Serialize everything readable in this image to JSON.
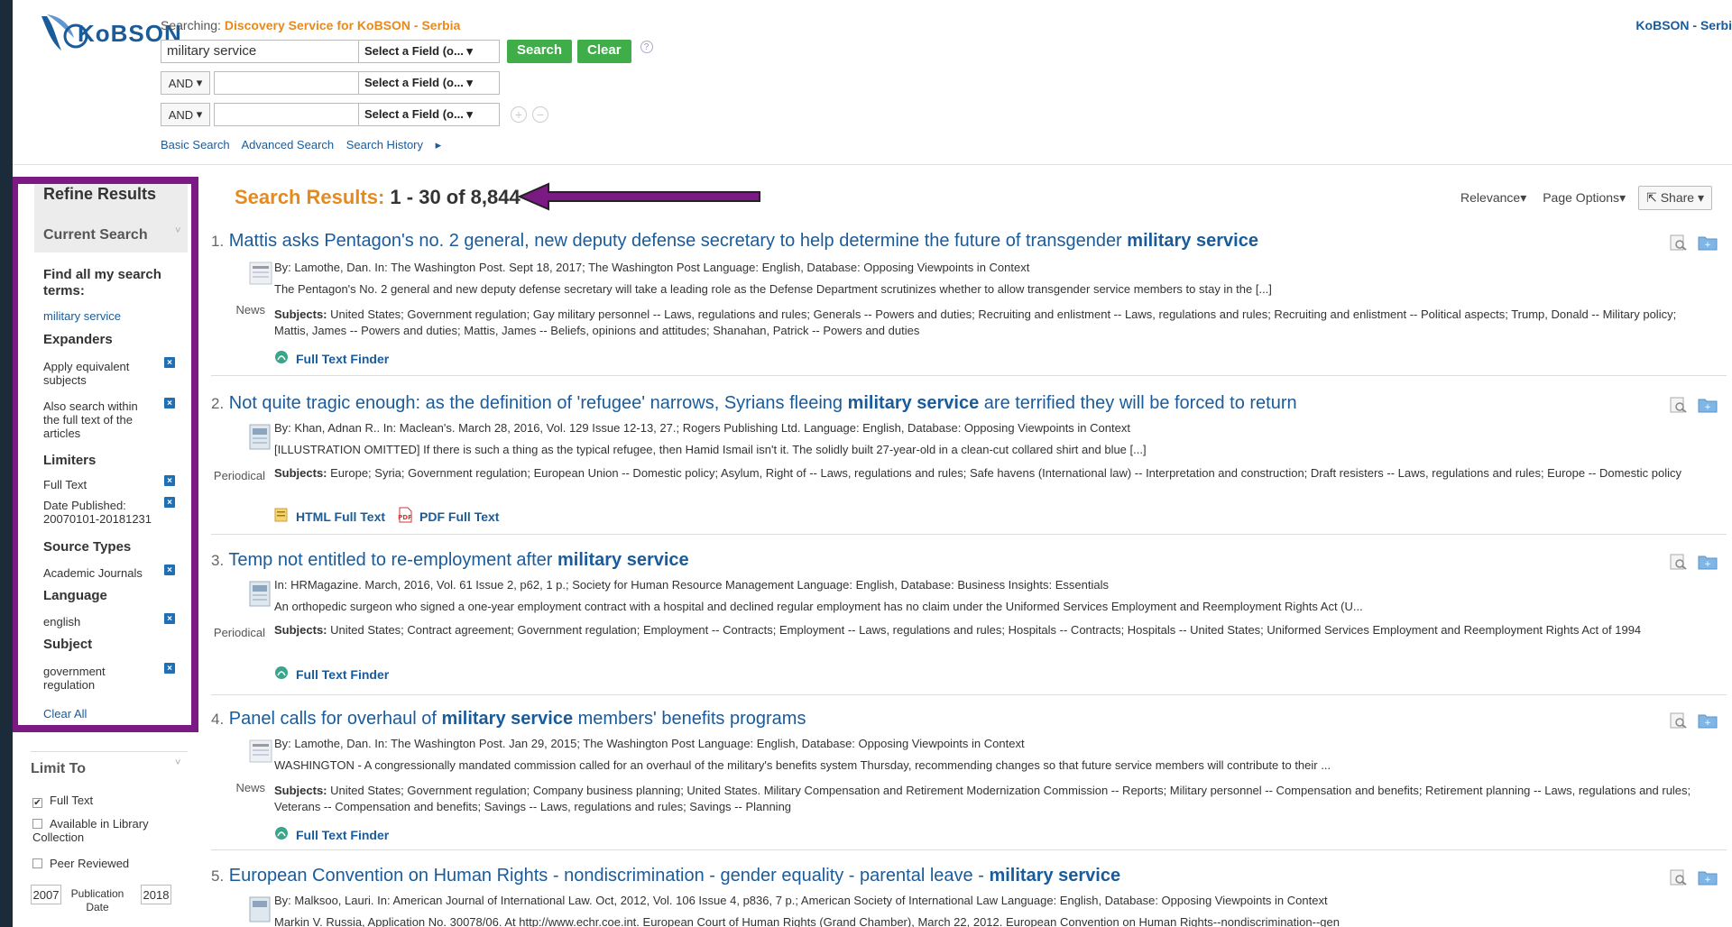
{
  "header": {
    "logo_text": "KoBSON",
    "searching_label": "Searching:",
    "database": "Discovery Service for KoBSON - Serbia",
    "top_right": "KoBSON - Serbi",
    "rows": [
      {
        "bool": "",
        "value": "military service",
        "field": "Select a Field (o...",
        "search": "Search",
        "clear": "Clear"
      },
      {
        "bool": "AND",
        "value": "",
        "field": "Select a Field (o..."
      },
      {
        "bool": "AND",
        "value": "",
        "field": "Select a Field (o..."
      }
    ],
    "links": [
      "Basic Search",
      "Advanced Search",
      "Search History"
    ]
  },
  "sidebar": {
    "refine_results": "Refine Results",
    "current_search": "Current Search",
    "find_all_terms": "Find all my search terms:",
    "search_term": "military service",
    "expanders": "Expanders",
    "expander_items": [
      "Apply equivalent subjects",
      "Also search within the full text of the articles"
    ],
    "limiters": "Limiters",
    "limiter_items": [
      "Full Text",
      "Date Published: 20070101-20181231"
    ],
    "source_types": "Source Types",
    "source_items": [
      "Academic Journals"
    ],
    "language": "Language",
    "language_items": [
      "english"
    ],
    "subject": "Subject",
    "subject_items": [
      "government regulation"
    ],
    "clear_all": "Clear All",
    "limit_to": "Limit To",
    "limit_to_items": [
      {
        "label": "Full Text",
        "checked": true
      },
      {
        "label": "Available in Library Collection",
        "checked": false
      },
      {
        "label": "Peer Reviewed",
        "checked": false
      }
    ],
    "pub_from": "2007",
    "pub_label": "Publication Date",
    "pub_to": "2018"
  },
  "results": {
    "label": "Search Results:",
    "range": "1 - 30 of 8,844",
    "sort": "Relevance",
    "page_options": "Page Options",
    "share": "Share",
    "items": [
      {
        "idx": "1.",
        "title_pre": "Mattis asks Pentagon's no. 2 general, new deputy defense secretary to help determine the future of transgender ",
        "title_bold": "military service",
        "title_post": "",
        "meta": "By: Lamothe, Dan. In: The Washington Post. Sept 18, 2017; The Washington Post Language: English, Database: Opposing Viewpoints in Context",
        "abstract": "The Pentagon's No. 2 general and new deputy defense secretary will take a leading role as the Defense Department scrutinizes whether to allow transgender service members to stay in the [...]",
        "type": "News",
        "subjects_label": "Subjects:",
        "subjects": "United States; Government regulation; Gay military personnel -- Laws, regulations and rules; Generals -- Powers and duties; Recruiting and enlistment -- Laws, regulations and rules; Recruiting and enlistment -- Political aspects; Trump, Donald -- Military policy; Mattis, James -- Powers and duties; Mattis, James -- Beliefs, opinions and attitudes; Shanahan, Patrick -- Powers and duties",
        "links": [
          "Full Text Finder"
        ]
      },
      {
        "idx": "2.",
        "title_pre": "Not quite tragic enough: as the definition of 'refugee' narrows, Syrians fleeing ",
        "title_bold": "military service",
        "title_post": " are terrified they will be forced to return",
        "meta": "By: Khan, Adnan R.. In: Maclean's. March 28, 2016, Vol. 129 Issue 12-13, 27.; Rogers Publishing Ltd. Language: English, Database: Opposing Viewpoints in Context",
        "abstract": "[ILLUSTRATION OMITTED] If there is such a thing as the typical refugee, then Hamid Ismail isn't it. The solidly built 27-year-old in a clean-cut collared shirt and blue [...]",
        "type": "Periodical",
        "subjects_label": "Subjects:",
        "subjects": "Europe; Syria; Government regulation; European Union -- Domestic policy; Asylum, Right of -- Laws, regulations and rules; Safe havens (International law) -- Interpretation and construction; Draft resisters -- Laws, regulations and rules; Europe -- Domestic policy",
        "links": [
          "HTML Full Text",
          "PDF Full Text"
        ]
      },
      {
        "idx": "3.",
        "title_pre": "Temp not entitled to re-employment after ",
        "title_bold": "military service",
        "title_post": "",
        "meta": "In: HRMagazine. March, 2016, Vol. 61 Issue 2, p62, 1 p.; Society for Human Resource Management Language: English, Database: Business Insights: Essentials",
        "abstract": "An orthopedic surgeon who signed a one-year employment contract with a hospital and declined regular employment has no claim under the Uniformed Services Employment and Reemployment Rights Act (U...",
        "type": "Periodical",
        "subjects_label": "Subjects:",
        "subjects": "United States; Contract agreement; Government regulation; Employment -- Contracts; Employment -- Laws, regulations and rules; Hospitals -- Contracts; Hospitals -- United States; Uniformed Services Employment and Reemployment Rights Act of 1994",
        "links": [
          "Full Text Finder"
        ]
      },
      {
        "idx": "4.",
        "title_pre": "Panel calls for overhaul of ",
        "title_bold": "military service",
        "title_post": " members' benefits programs",
        "meta": "By: Lamothe, Dan. In: The Washington Post. Jan 29, 2015; The Washington Post Language: English, Database: Opposing Viewpoints in Context",
        "abstract": "WASHINGTON - A congressionally mandated commission called for an overhaul of the military's benefits system Thursday, recommending changes so that future service members will contribute to their ...",
        "type": "News",
        "subjects_label": "Subjects:",
        "subjects": "United States; Government regulation; Company business planning; United States. Military Compensation and Retirement Modernization Commission -- Reports; Military personnel -- Compensation and benefits; Retirement planning -- Laws, regulations and rules; Veterans -- Compensation and benefits; Savings -- Laws, regulations and rules; Savings -- Planning",
        "links": [
          "Full Text Finder"
        ]
      },
      {
        "idx": "5.",
        "title_pre": "European Convention on Human Rights - nondiscrimination - gender equality - parental leave - ",
        "title_bold": "military service",
        "title_post": "",
        "meta": "By: Malksoo, Lauri. In: American Journal of International Law. Oct, 2012, Vol. 106 Issue 4, p836, 7 p.; American Society of International Law Language: English, Database: Opposing Viewpoints in Context",
        "abstract": "Markin V. Russia, Application No. 30078/06. At http://www.echr.coe.int. European Court of Human Rights (Grand Chamber), March 22, 2012. European Convention on Human Rights--nondiscrimination--gen",
        "type": "",
        "subjects_label": "",
        "subjects": "",
        "links": []
      }
    ]
  },
  "colors": {
    "accent_orange": "#e68a1e",
    "link_blue": "#1a5b9a",
    "green_button": "#3fae49",
    "highlight_purple": "#7a1a82"
  }
}
